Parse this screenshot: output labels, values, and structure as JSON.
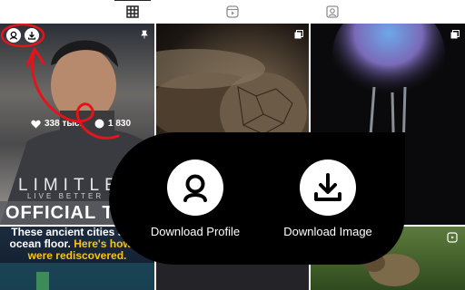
{
  "tabs": [
    {
      "name": "grid",
      "icon": "grid-icon",
      "active": true
    },
    {
      "name": "reels",
      "icon": "reels-icon",
      "active": false
    },
    {
      "name": "tagged",
      "icon": "tagged-icon",
      "active": false
    }
  ],
  "posts": {
    "first": {
      "likes": "338 тыс.",
      "comments": "1 830",
      "overlay_text": "LIMITLE",
      "tagline": "LIVE BETTER NO",
      "title_strip": "OFFICIAL TRA"
    },
    "fourth": {
      "headline_white": "These ancient cities sunk",
      "headline_white2": "ocean floor.",
      "headline_yellow": "Here's how th",
      "headline_yellow2": "were rediscovered."
    }
  },
  "popup": {
    "profile_label": "Download Profile",
    "image_label": "Download Image"
  },
  "colors": {
    "annotation_red": "#e3141b",
    "accent_yellow": "#f5c518"
  }
}
